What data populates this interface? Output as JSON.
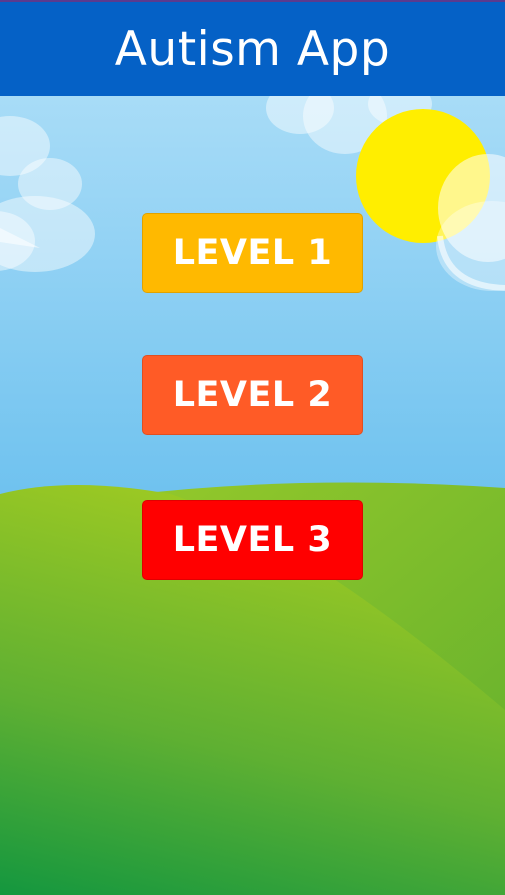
{
  "app": {
    "title": "Autism App"
  },
  "levels": [
    {
      "label": "LEVEL 1",
      "color": "#ffb900"
    },
    {
      "label": "LEVEL 2",
      "color": "#ff5b26"
    },
    {
      "label": "LEVEL 3",
      "color": "#ff0000"
    }
  ],
  "colors": {
    "titlebar": "#0561c6",
    "sky": "#5fb8ec",
    "sun": "#ffee00",
    "hill": "#7fbf2a"
  },
  "icons": [
    "sun-icon",
    "cloud-icon"
  ]
}
